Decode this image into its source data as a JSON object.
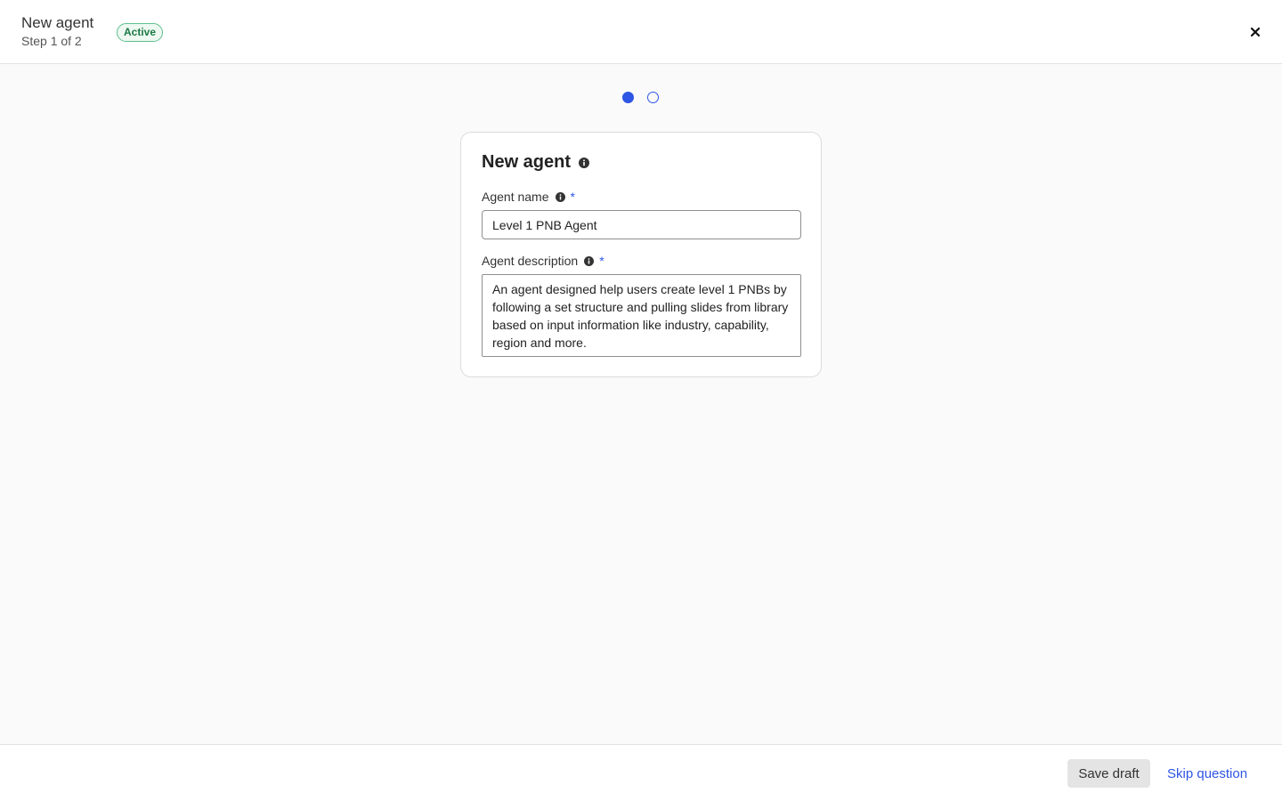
{
  "header": {
    "title": "New agent",
    "subtitle": "Step 1 of 2",
    "status_badge": "Active",
    "close_icon": "close-icon"
  },
  "stepper": {
    "total_steps": 2,
    "current_step": 1,
    "accent_color": "#2f55e4"
  },
  "form": {
    "title": "New agent",
    "title_icon": "info-icon",
    "agent_name": {
      "label": "Agent name",
      "required_marker": "*",
      "value": "Level 1 PNB Agent"
    },
    "agent_description": {
      "label": "Agent description",
      "required_marker": "*",
      "value": "An agent designed help users create level 1 PNBs by following a set structure and pulling slides from library based on input information like industry, capability, region and more."
    }
  },
  "footer": {
    "save_label": "Save draft",
    "skip_label": "Skip question"
  },
  "colors": {
    "accent": "#2f55e4",
    "badge_green": "#1c7a45",
    "background": "#fafafa"
  }
}
